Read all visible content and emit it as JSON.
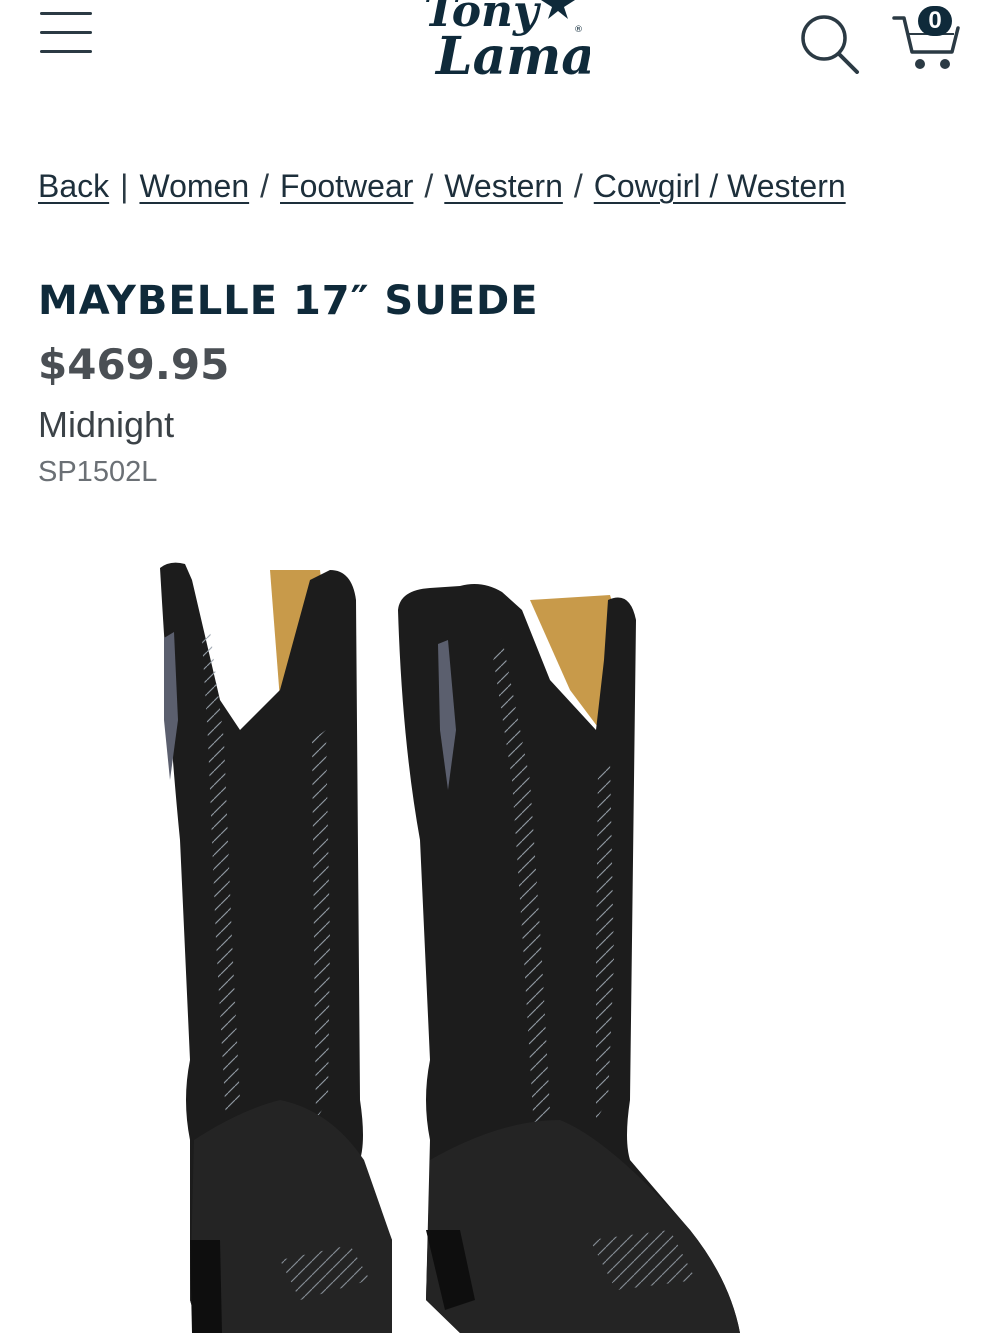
{
  "header": {
    "logo_text": "Tony Lama",
    "menu_icon": "hamburger-menu-icon",
    "search_icon": "search-icon",
    "cart_icon": "cart-icon",
    "cart_count": "0"
  },
  "breadcrumb": {
    "back": "Back",
    "separator_back": "|",
    "items": [
      {
        "label": "Women"
      },
      {
        "label": "Footwear"
      },
      {
        "label": "Western"
      },
      {
        "label": "Cowgirl / Western"
      }
    ],
    "separator": "/"
  },
  "product": {
    "title": "MAYBELLE 17″ SUEDE",
    "price": "$469.95",
    "color": "Midnight",
    "sku": "SP1502L"
  },
  "colors": {
    "brand_navy": "#0f2a3a",
    "price_gray": "#4a4f54",
    "boot_black": "#1c1c1c",
    "boot_lining": "#c89a4a"
  }
}
